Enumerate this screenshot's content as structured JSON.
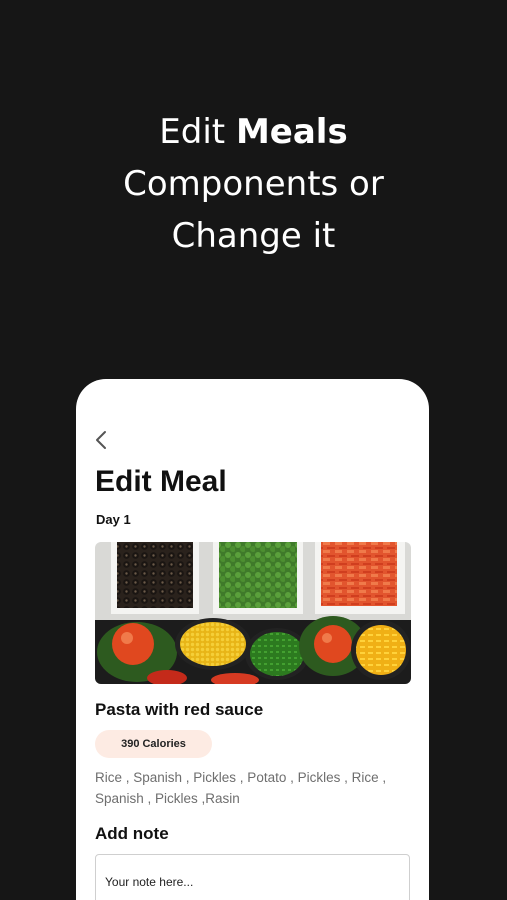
{
  "headline": {
    "line1_normal": "Edit ",
    "line1_bold": "Meals",
    "line2": "Components or",
    "line3": "Change it"
  },
  "screen": {
    "back_icon": "chevron-left-icon",
    "title": "Edit Meal",
    "day": "Day 1",
    "meal_image": "photo of bowls of vegetables: olives, broccoli, tomatoes, corn, peppers",
    "meal_name": "Pasta with red sauce",
    "calories": "390 Calories",
    "ingredients": "Rice , Spanish , Pickles , Potato , Pickles , Rice , Spanish , Pickles ,Rasin",
    "note_label": "Add note",
    "note_placeholder": "Your note here..."
  },
  "colors": {
    "background": "#161616",
    "calorie_badge": "#fdebe3"
  }
}
